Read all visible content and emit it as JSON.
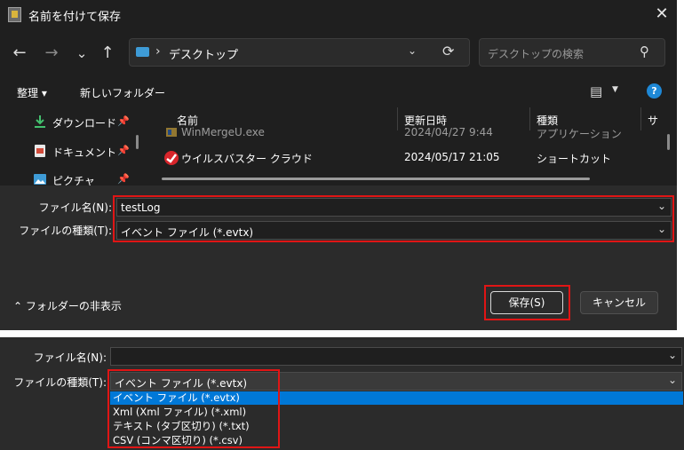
{
  "dialog": {
    "title": "名前を付けて保存",
    "close_glyph": "✕"
  },
  "nav": {
    "back_glyph": "←",
    "forward_glyph": "→",
    "recent_glyph": "⌄",
    "up_glyph": "↑"
  },
  "address": {
    "separator": "›",
    "path": "デスクトップ",
    "dropdown_glyph": "⌄",
    "refresh_glyph": "⟳"
  },
  "search": {
    "placeholder": "デスクトップの検索",
    "icon_glyph": "⚲"
  },
  "toolbar": {
    "organize_label": "整理 ▾",
    "new_folder_label": "新しいフォルダー",
    "view_glyph": "▤",
    "view_caret": "▼",
    "help_glyph": "?"
  },
  "nav_pane": {
    "items": [
      {
        "label": "ダウンロード",
        "icon": "download-icon",
        "pin": "📌"
      },
      {
        "label": "ドキュメント",
        "icon": "document-icon",
        "pin": "📌"
      },
      {
        "label": "ピクチャ",
        "icon": "pictures-icon",
        "pin": "📌"
      }
    ]
  },
  "file_list": {
    "sort_glyph": "^",
    "columns": [
      "名前",
      "更新日時",
      "種類",
      "サ"
    ],
    "rows": [
      {
        "name": "WinMergeU.exe",
        "date": "2024/04/27 9:44",
        "type": "アプリケーション"
      },
      {
        "name": "ウイルスバスター クラウド",
        "date": "2024/05/17 21:05",
        "type": "ショートカット"
      }
    ]
  },
  "form": {
    "filename_label": "ファイル名(N):",
    "filename_value": "testLog",
    "filetype_label": "ファイルの種類(T):",
    "filetype_value": "イベント ファイル (*.evtx)",
    "caret": "⌄"
  },
  "footer": {
    "hide_folders_label": "フォルダーの非表示",
    "hide_folders_glyph": "⌃",
    "save_label": "保存(S)",
    "cancel_label": "キャンセル"
  },
  "panel2": {
    "filename_label": "ファイル名(N):",
    "filename_value": "",
    "filetype_label": "ファイルの種類(T):",
    "filetype_value": "イベント ファイル (*.evtx)",
    "caret": "⌄",
    "options": [
      "イベント ファイル (*.evtx)",
      "Xml (Xml ファイル) (*.xml)",
      "テキスト (タブ区切り) (*.txt)",
      "CSV (コンマ区切り) (*.csv)"
    ],
    "selected_index": 0
  },
  "colors": {
    "accent": "#0078d7",
    "highlight_box": "#e01515",
    "dialog_bg": "#1f1f1f",
    "panel_bg": "#2b2b2b"
  }
}
